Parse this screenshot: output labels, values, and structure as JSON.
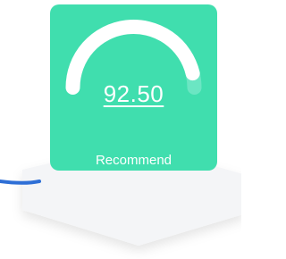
{
  "card": {
    "score": "92.50",
    "label": "Recommend",
    "level": 0.925,
    "colors": {
      "background": "#40DEAE",
      "arc_filled": "#FFFFFF",
      "arc_remaining": "#6BE6C3"
    }
  },
  "decor": {
    "shape_color": "#F4F5F7",
    "line_color": "#2E6FD6"
  }
}
